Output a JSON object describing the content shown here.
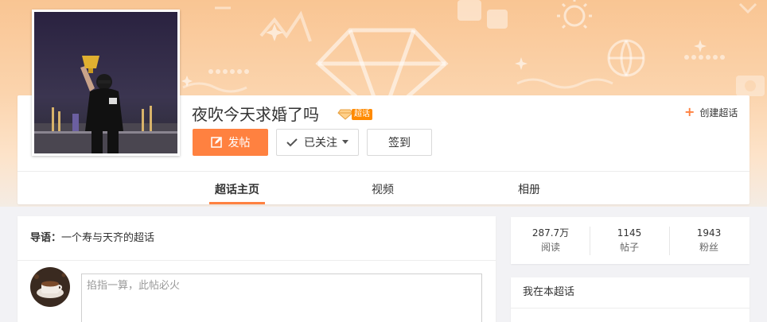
{
  "topic": {
    "title": "夜吹今天求婚了吗",
    "badge": "超话",
    "create_label": "创建超话"
  },
  "actions": {
    "post_label": "发帖",
    "follow_label": "已关注",
    "signin_label": "签到"
  },
  "tabs": [
    {
      "label": "超话主页",
      "active": true
    },
    {
      "label": "视频",
      "active": false
    },
    {
      "label": "相册",
      "active": false
    }
  ],
  "intro": {
    "prefix": "导语：",
    "text": "一个寿与天齐的超话"
  },
  "composer": {
    "placeholder": "掐指一算，此帖必火"
  },
  "stats": [
    {
      "value": "287.7万",
      "label": "阅读"
    },
    {
      "value": "1145",
      "label": "帖子"
    },
    {
      "value": "1943",
      "label": "粉丝"
    }
  ],
  "sidebar": {
    "my_section_title": "我在本超话"
  },
  "colors": {
    "accent": "#ff8140",
    "badge": "#ff8a00",
    "banner": "#f9c593"
  }
}
